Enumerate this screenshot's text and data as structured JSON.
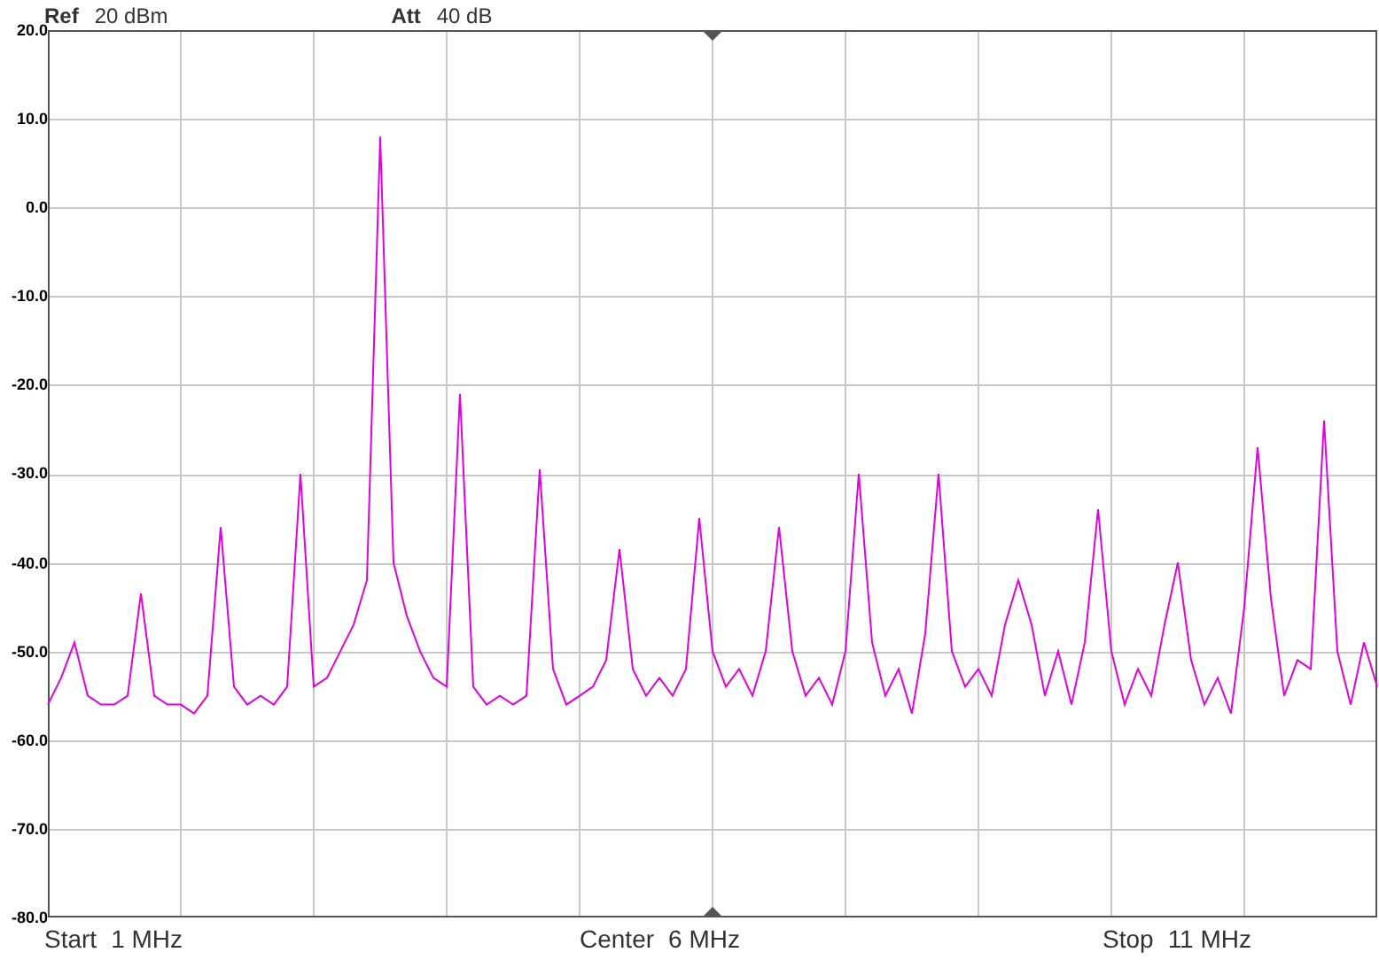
{
  "header": {
    "ref_label": "Ref",
    "ref_value": "20 dBm",
    "att_label": "Att",
    "att_value": "40 dB"
  },
  "chart_data": {
    "type": "line",
    "grid": true,
    "ylim": [
      -80,
      20
    ],
    "yticks": [
      {
        "value": 20,
        "label": "20.0"
      },
      {
        "value": 10,
        "label": "10.0"
      },
      {
        "value": 0,
        "label": "0.0"
      },
      {
        "value": -10,
        "label": "-10.0"
      },
      {
        "value": -20,
        "label": "-20.0"
      },
      {
        "value": -30,
        "label": "-30.0"
      },
      {
        "value": -40,
        "label": "-40.0"
      },
      {
        "value": -50,
        "label": "-50.0"
      },
      {
        "value": -60,
        "label": "-60.0"
      },
      {
        "value": -70,
        "label": "-70.0"
      },
      {
        "value": -80,
        "label": "-80.0"
      }
    ],
    "categories": [
      null,
      null,
      null,
      null,
      null,
      null,
      null,
      null,
      null,
      null,
      null,
      null,
      null,
      null,
      null,
      null,
      null,
      null,
      null,
      null,
      null,
      null,
      null,
      null,
      null,
      null,
      null,
      null,
      null,
      null,
      null,
      null,
      null,
      null,
      null,
      null,
      null,
      null,
      null,
      null,
      null,
      null,
      null,
      null,
      null,
      null,
      null,
      null,
      null,
      null,
      null,
      null,
      null,
      null,
      null,
      null,
      null,
      null,
      null,
      null,
      null,
      null,
      null,
      null,
      null,
      null,
      null,
      null,
      null,
      null,
      null,
      null,
      null,
      null,
      null,
      null,
      null,
      null,
      null,
      null,
      null,
      null,
      null,
      null,
      null,
      null,
      null,
      null,
      null,
      null,
      null,
      null,
      null,
      null,
      null,
      null,
      null,
      null,
      null,
      null,
      null
    ],
    "series": [
      {
        "color": "#e000e0",
        "values": [
          -56,
          -53,
          -49,
          -55,
          -56,
          -56,
          -55,
          -43.5,
          -55,
          -56,
          -56,
          -57,
          -55,
          -36,
          -54,
          -56,
          -55,
          -56,
          -54,
          -30,
          -54,
          -53,
          -50,
          -47,
          -42,
          8,
          -40,
          -46,
          -50,
          -53,
          -54,
          -21,
          -54,
          -56,
          -55,
          -56,
          -55,
          -29.5,
          -52,
          -56,
          -55,
          -54,
          -51,
          -38.5,
          -52,
          -55,
          -53,
          -55,
          -52,
          -35,
          -50,
          -54,
          -52,
          -55,
          -50,
          -36,
          -50,
          -55,
          -53,
          -56,
          -50,
          -30,
          -49,
          -55,
          -52,
          -57,
          -48,
          -30,
          -50,
          -54,
          -52,
          -55,
          -47,
          -42,
          -47,
          -55,
          -50,
          -56,
          -49,
          -34,
          -50,
          -56,
          -52,
          -55,
          -47,
          -40,
          -51,
          -56,
          -53,
          -57,
          -45,
          -27,
          -44,
          -55,
          -51,
          -52,
          -24,
          -50,
          -56,
          -49,
          -54
        ]
      }
    ]
  },
  "footer": [
    {
      "label": "Start",
      "value": "1 MHz"
    },
    {
      "label": "Center",
      "value": "6 MHz"
    },
    {
      "label": "Stop",
      "value": "11 MHz"
    }
  ]
}
